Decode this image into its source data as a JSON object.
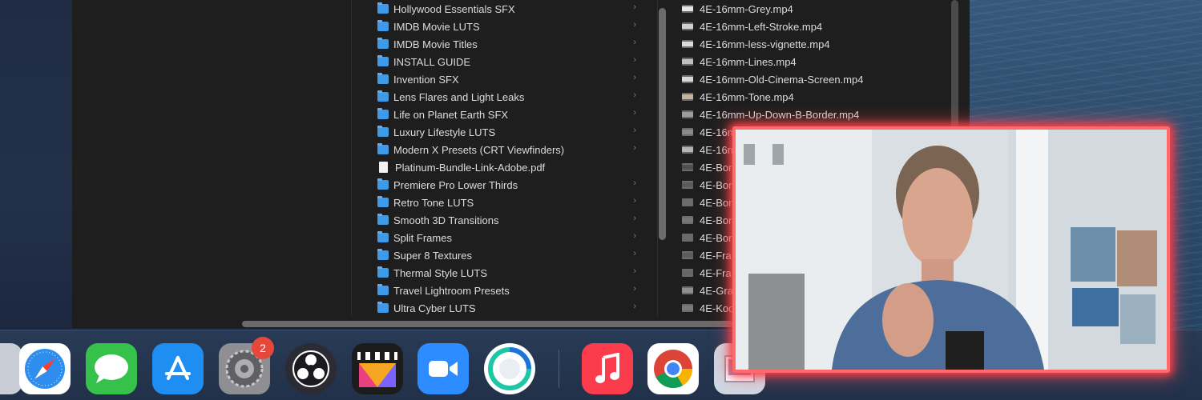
{
  "folders": [
    {
      "name": "Hollywood Essentials SFX",
      "type": "folder"
    },
    {
      "name": "IMDB Movie LUTS",
      "type": "folder"
    },
    {
      "name": "IMDB Movie Titles",
      "type": "folder"
    },
    {
      "name": "INSTALL GUIDE",
      "type": "folder"
    },
    {
      "name": "Invention SFX",
      "type": "folder"
    },
    {
      "name": "Lens Flares and Light Leaks",
      "type": "folder"
    },
    {
      "name": "Life on Planet Earth SFX",
      "type": "folder"
    },
    {
      "name": "Luxury Lifestyle LUTS",
      "type": "folder"
    },
    {
      "name": "Modern X Presets (CRT Viewfinders)",
      "type": "folder"
    },
    {
      "name": "Platinum-Bundle-Link-Adobe.pdf",
      "type": "pdf"
    },
    {
      "name": "Premiere Pro Lower Thirds",
      "type": "folder"
    },
    {
      "name": "Retro Tone LUTS",
      "type": "folder"
    },
    {
      "name": "Smooth 3D Transitions",
      "type": "folder"
    },
    {
      "name": "Split Frames",
      "type": "folder"
    },
    {
      "name": "Super 8 Textures",
      "type": "folder"
    },
    {
      "name": "Thermal Style LUTS",
      "type": "folder"
    },
    {
      "name": "Travel Lightroom Presets",
      "type": "folder"
    },
    {
      "name": "Ultra Cyber LUTS",
      "type": "folder"
    }
  ],
  "files": [
    {
      "name": "4E-16mm-Grey.mp4"
    },
    {
      "name": "4E-16mm-Left-Stroke.mp4"
    },
    {
      "name": "4E-16mm-less-vignette.mp4"
    },
    {
      "name": "4E-16mm-Lines.mp4"
    },
    {
      "name": "4E-16mm-Old-Cinema-Screen.mp4"
    },
    {
      "name": "4E-16mm-Tone.mp4"
    },
    {
      "name": "4E-16mm-Up-Down-B-Border.mp4"
    },
    {
      "name": "4E-16m"
    },
    {
      "name": "4E-16m"
    },
    {
      "name": "4E-Bor"
    },
    {
      "name": "4E-Bor"
    },
    {
      "name": "4E-Bor"
    },
    {
      "name": "4E-Bor"
    },
    {
      "name": "4E-Bor"
    },
    {
      "name": "4E-Fra"
    },
    {
      "name": "4E-Fra"
    },
    {
      "name": "4E-Gra"
    },
    {
      "name": "4E-Koo"
    }
  ],
  "dock": {
    "apps": [
      {
        "name": "safari-icon",
        "color": "#2e8ef0"
      },
      {
        "name": "messages-icon",
        "color": "#36c24a"
      },
      {
        "name": "app-store-icon",
        "color": "#1f8ef2"
      },
      {
        "name": "system-preferences-icon",
        "color": "#8e8e93"
      },
      {
        "name": "obs-icon",
        "color": "#2b2b33"
      },
      {
        "name": "final-cut-pro-icon",
        "color": "#1c1c1c"
      },
      {
        "name": "zoom-icon",
        "color": "#2d8cff"
      },
      {
        "name": "webex-icon",
        "color": "#ffffff"
      },
      {
        "name": "music-icon",
        "color": "#fa3c4c"
      },
      {
        "name": "chrome-icon",
        "color": "#ffffff"
      },
      {
        "name": "preview-icon",
        "color": "#cfd8e3"
      }
    ],
    "system_preferences_badge": "2"
  },
  "overlay": {
    "frame_color": "#ff5a5f"
  }
}
